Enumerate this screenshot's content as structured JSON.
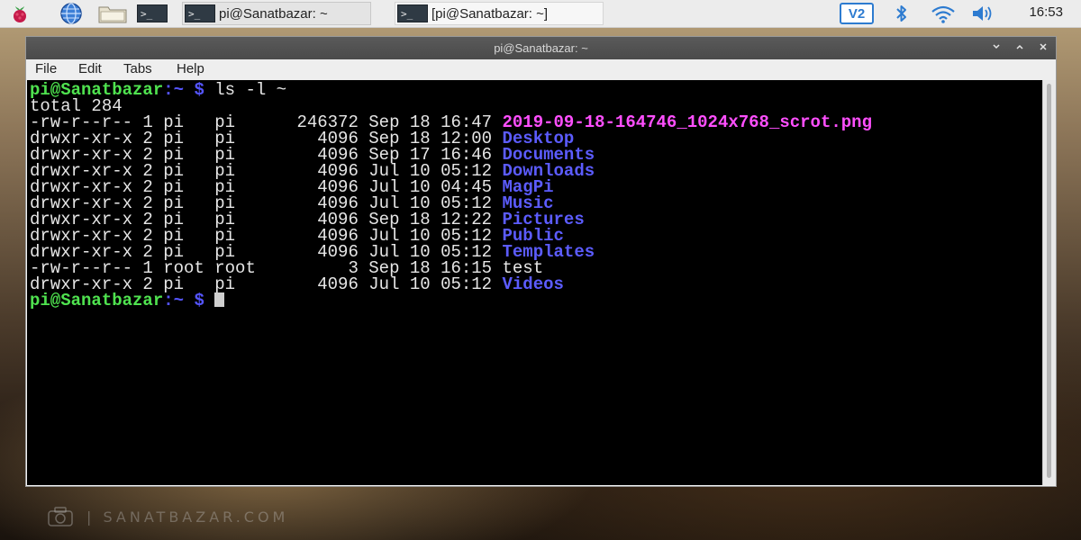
{
  "taskbar": {
    "launcher_icons": [
      "raspberry-menu-icon",
      "web-browser-icon",
      "file-manager-icon",
      "terminal-launcher-icon"
    ],
    "terminal_glyph": ">_",
    "tasks": [
      {
        "label": "pi@Sanatbazar: ~",
        "active": false
      },
      {
        "label": "[pi@Sanatbazar: ~]",
        "active": true
      }
    ],
    "tray_icons": [
      "vnc-icon",
      "bluetooth-icon",
      "wifi-icon",
      "volume-icon"
    ],
    "vnc_text": "V2",
    "clock": "16:53"
  },
  "window": {
    "title": "pi@Sanatbazar: ~",
    "controls": [
      "minimize-icon",
      "maximize-icon",
      "close-icon"
    ],
    "menu": [
      "File",
      "Edit",
      "Tabs",
      "Help"
    ]
  },
  "terminal": {
    "prompt_user": "pi@Sanatbazar",
    "prompt_tail": ":~ $",
    "command": "ls -l ~",
    "total": "total 284",
    "listing": [
      {
        "perms": "-rw-r--r--",
        "links": "1",
        "owner": "pi",
        "group": "pi",
        "size": "246372",
        "date": "Sep 18 16:47",
        "name": "2019-09-18-164746_1024x768_scrot.png",
        "kind": "img"
      },
      {
        "perms": "drwxr-xr-x",
        "links": "2",
        "owner": "pi",
        "group": "pi",
        "size": "4096",
        "date": "Sep 18 12:00",
        "name": "Desktop",
        "kind": "dir"
      },
      {
        "perms": "drwxr-xr-x",
        "links": "2",
        "owner": "pi",
        "group": "pi",
        "size": "4096",
        "date": "Sep 17 16:46",
        "name": "Documents",
        "kind": "dir"
      },
      {
        "perms": "drwxr-xr-x",
        "links": "2",
        "owner": "pi",
        "group": "pi",
        "size": "4096",
        "date": "Jul 10 05:12",
        "name": "Downloads",
        "kind": "dir"
      },
      {
        "perms": "drwxr-xr-x",
        "links": "2",
        "owner": "pi",
        "group": "pi",
        "size": "4096",
        "date": "Jul 10 04:45",
        "name": "MagPi",
        "kind": "dir"
      },
      {
        "perms": "drwxr-xr-x",
        "links": "2",
        "owner": "pi",
        "group": "pi",
        "size": "4096",
        "date": "Jul 10 05:12",
        "name": "Music",
        "kind": "dir"
      },
      {
        "perms": "drwxr-xr-x",
        "links": "2",
        "owner": "pi",
        "group": "pi",
        "size": "4096",
        "date": "Sep 18 12:22",
        "name": "Pictures",
        "kind": "dir"
      },
      {
        "perms": "drwxr-xr-x",
        "links": "2",
        "owner": "pi",
        "group": "pi",
        "size": "4096",
        "date": "Jul 10 05:12",
        "name": "Public",
        "kind": "dir"
      },
      {
        "perms": "drwxr-xr-x",
        "links": "2",
        "owner": "pi",
        "group": "pi",
        "size": "4096",
        "date": "Jul 10 05:12",
        "name": "Templates",
        "kind": "dir"
      },
      {
        "perms": "-rw-r--r--",
        "links": "1",
        "owner": "root",
        "group": "root",
        "size": "3",
        "date": "Sep 18 16:15",
        "name": "test",
        "kind": "file"
      },
      {
        "perms": "drwxr-xr-x",
        "links": "2",
        "owner": "pi",
        "group": "pi",
        "size": "4096",
        "date": "Jul 10 05:12",
        "name": "Videos",
        "kind": "dir"
      }
    ]
  },
  "watermark": "| SANATBAZAR.COM",
  "colors": {
    "prompt_user": "#4fe24f",
    "prompt_tail": "#5555ff",
    "directory": "#5c5cff",
    "image_file": "#ff4fff",
    "terminal_bg": "#000000"
  }
}
